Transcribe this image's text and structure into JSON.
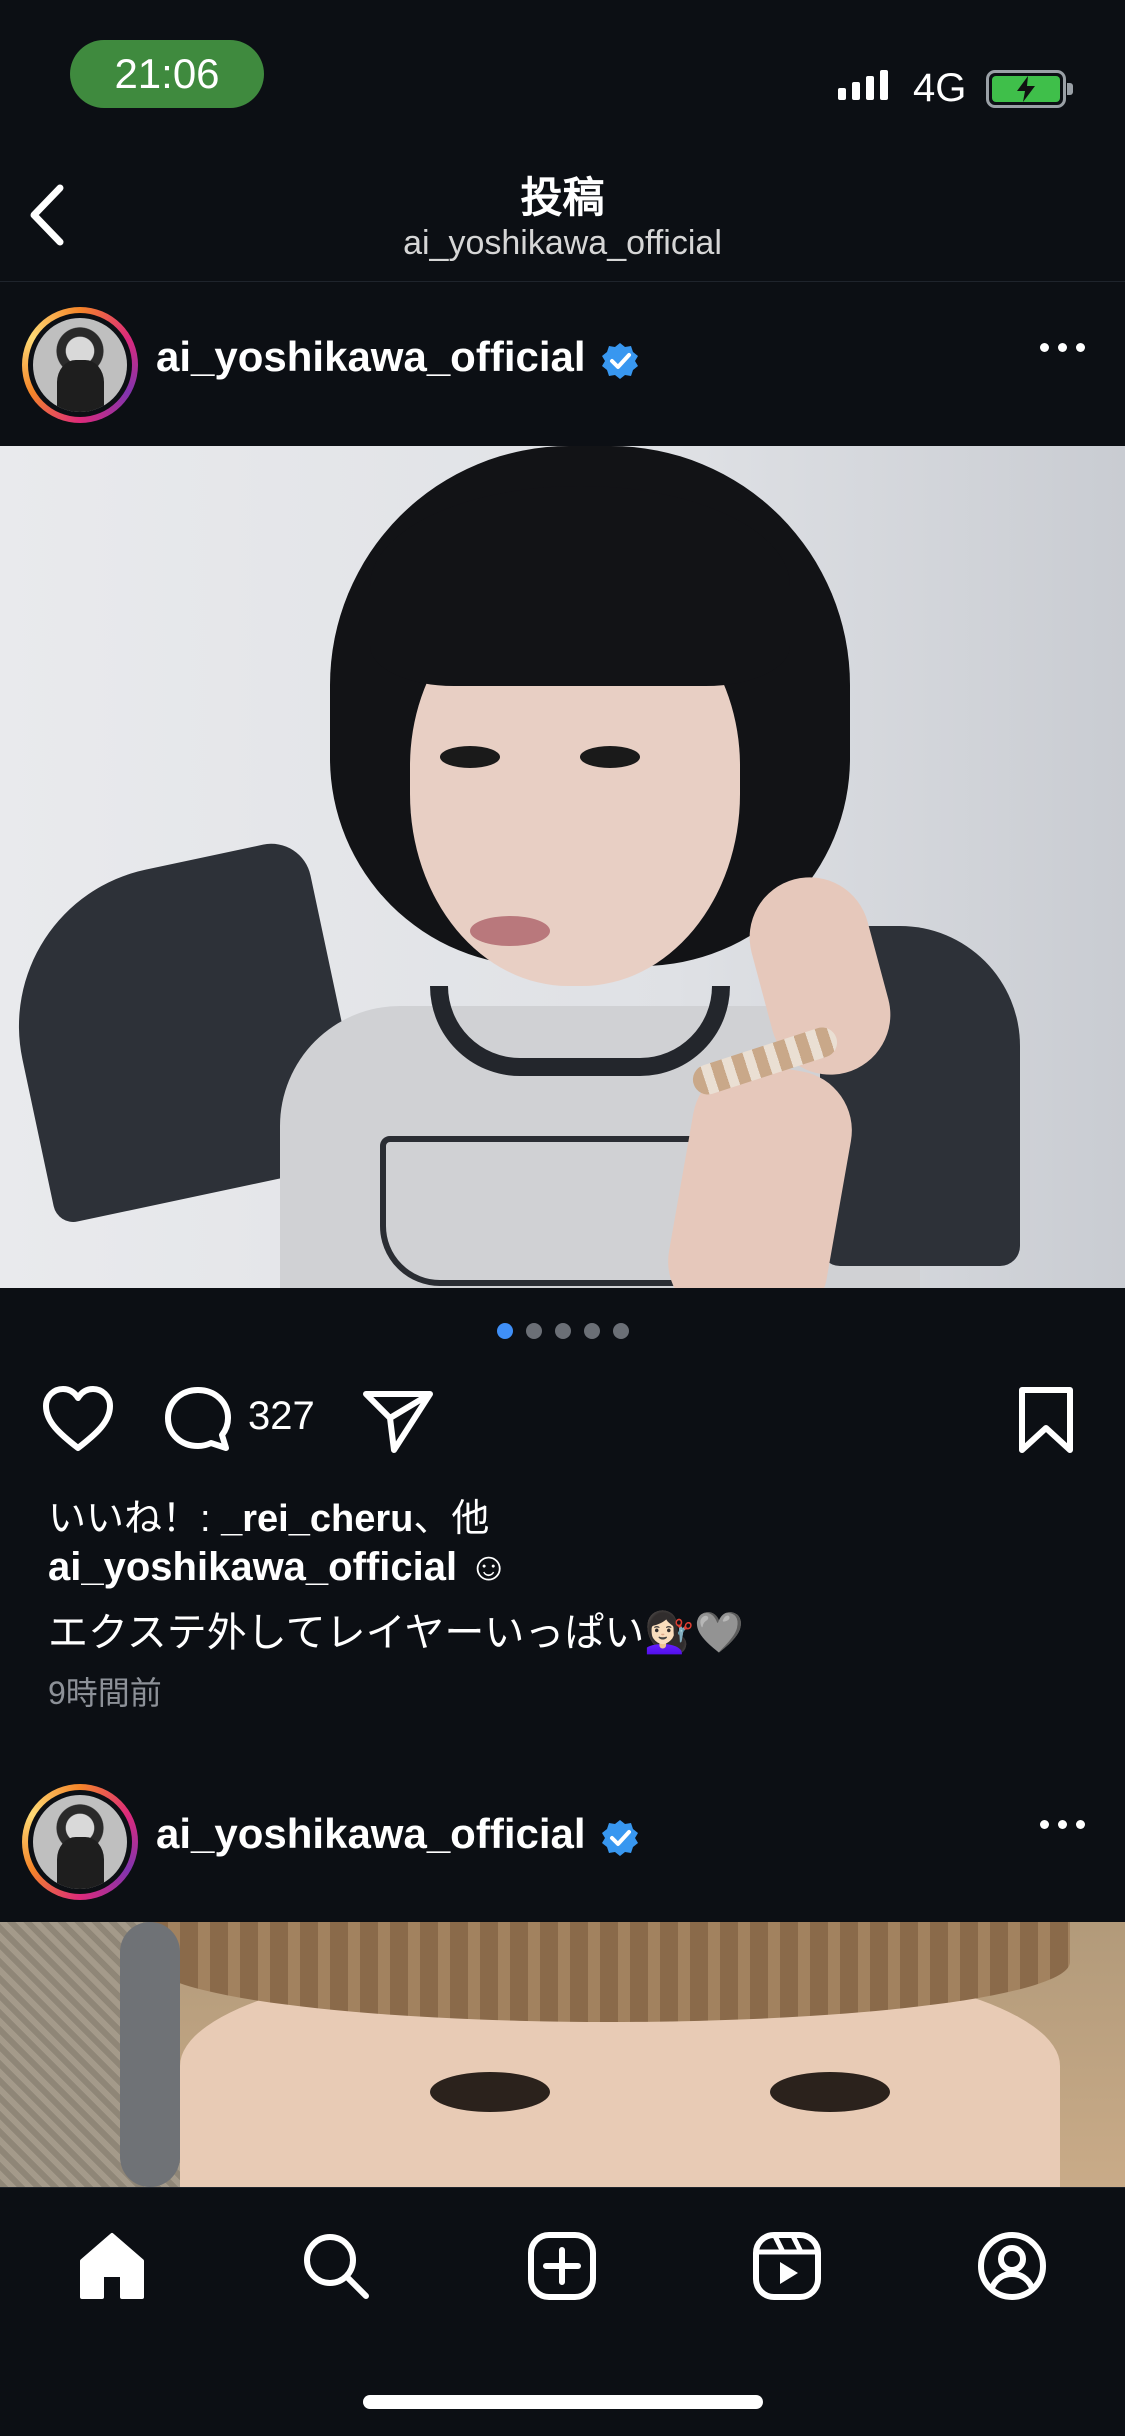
{
  "status_bar": {
    "time": "21:06",
    "network": "4G",
    "colors": {
      "time_pill": "#3f8a3e",
      "battery": "#3fbf4a"
    }
  },
  "nav": {
    "title": "投稿",
    "subtitle": "ai_yoshikawa_official"
  },
  "post1": {
    "username": "ai_yoshikawa_official",
    "verified": true,
    "carousel": {
      "count": 5,
      "active_index": 0
    },
    "comment_count": "327",
    "likes_prefix": "いいね！: ",
    "likes_user": "_rei_cheru",
    "likes_suffix": "、他",
    "caption_user": "ai_yoshikawa_official",
    "caption_line1_suffix": " ☺︎",
    "caption_line2": "エクステ外してレイヤーいっぱい💇🏻‍♀️🩶",
    "time_ago": "9時間前"
  },
  "post2": {
    "username": "ai_yoshikawa_official",
    "verified": true
  },
  "tabbar": {
    "items": [
      "home-icon",
      "search-icon",
      "create-icon",
      "reels-icon",
      "profile-icon"
    ],
    "active": "home-icon"
  },
  "colors": {
    "background": "#0c0f14",
    "accent": "#3f8ff7",
    "verified": "#3897f0"
  }
}
